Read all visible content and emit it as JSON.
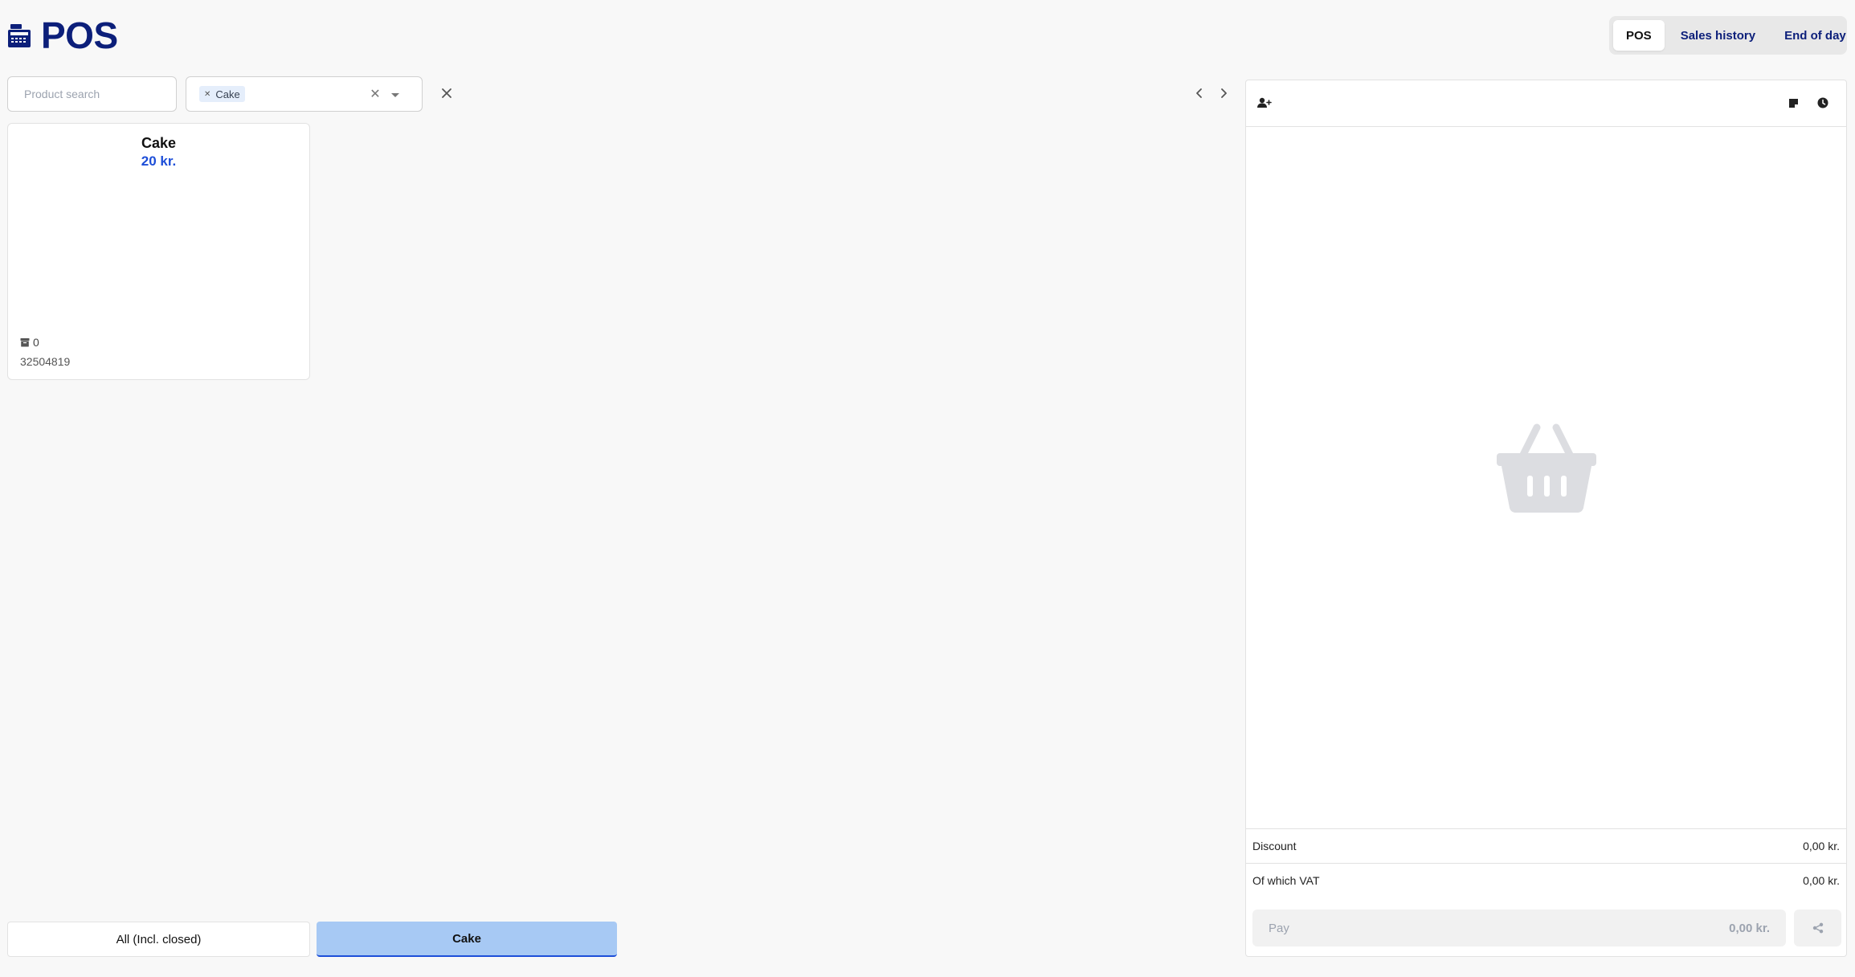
{
  "header": {
    "title": "POS",
    "tabs": [
      {
        "label": "POS",
        "active": true
      },
      {
        "label": "Sales history",
        "active": false
      },
      {
        "label": "End of day",
        "active": false
      }
    ]
  },
  "search": {
    "placeholder": "Product search",
    "value": ""
  },
  "category_filter": {
    "selected": [
      "Cake"
    ]
  },
  "products": [
    {
      "name": "Cake",
      "price": "20 kr.",
      "stock": "0",
      "sku": "32504819"
    }
  ],
  "category_buttons": [
    {
      "label": "All (Incl. closed)",
      "active": false
    },
    {
      "label": "Cake",
      "active": true
    }
  ],
  "cart": {
    "discount_label": "Discount",
    "discount_value": "0,00 kr.",
    "vat_label": "Of which VAT",
    "vat_value": "0,00 kr.",
    "pay_label": "Pay",
    "pay_total": "0,00 kr."
  },
  "colors": {
    "brand": "#0c1f7a",
    "price": "#1d4ed8",
    "active_category": "#a7c9f4",
    "background": "#f8f8f8"
  },
  "icons": {
    "app": "cash-register-icon",
    "add_customer": "user-plus-icon",
    "note": "note-icon",
    "history": "clock-icon",
    "empty_cart": "basket-icon",
    "share": "share-icon",
    "stock": "box-icon"
  }
}
